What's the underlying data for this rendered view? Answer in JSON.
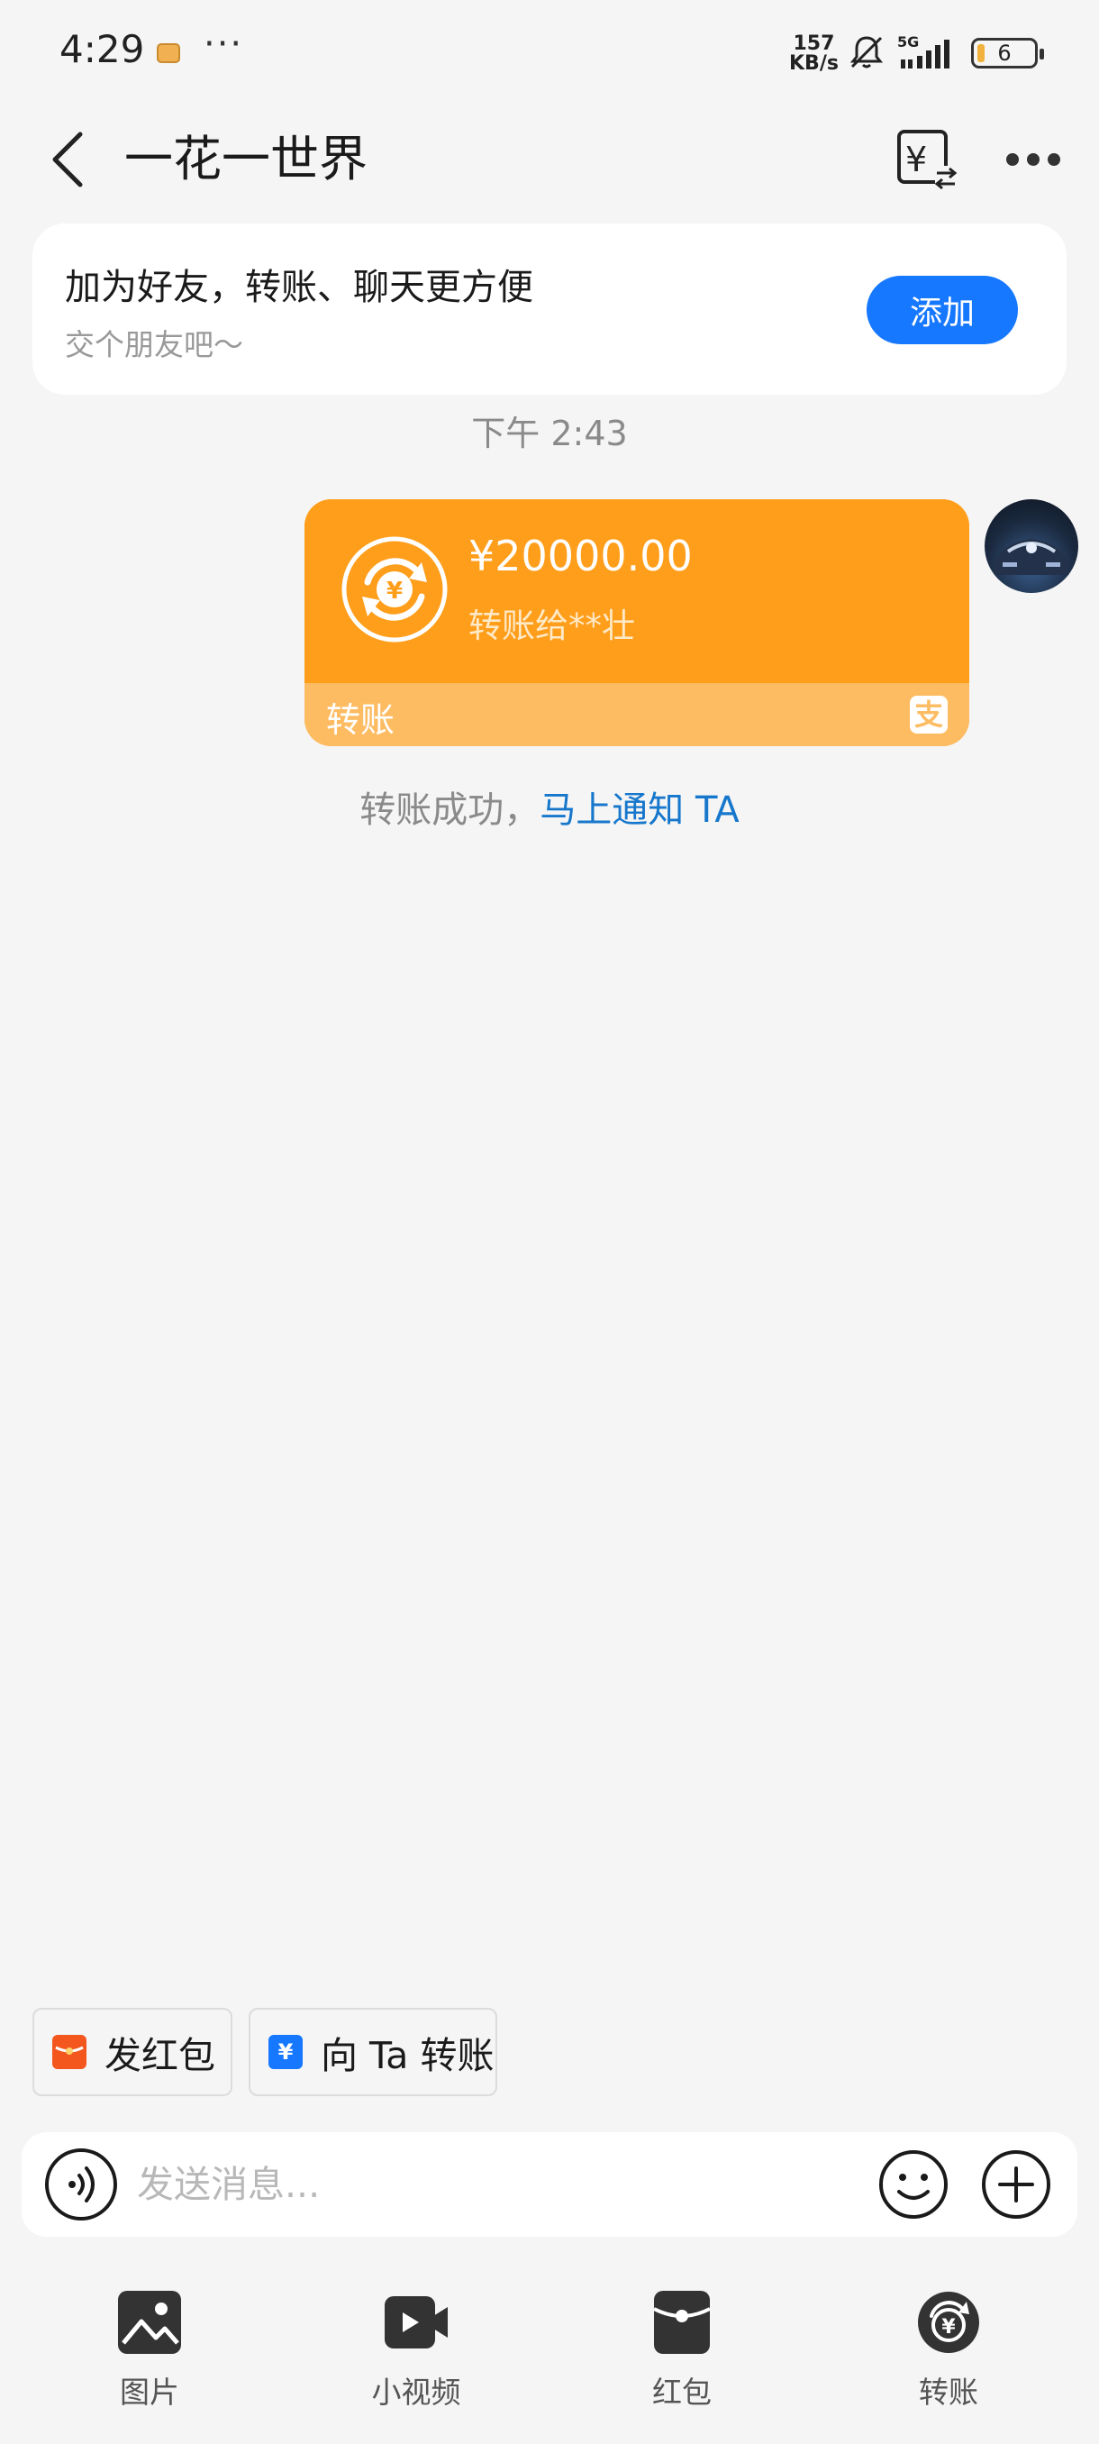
{
  "status_bar": {
    "time": "4:29",
    "dots": "···",
    "net_speed_value": "157",
    "net_speed_unit": "KB/s",
    "network": "5G",
    "battery": "6"
  },
  "header": {
    "title": "一花一世界"
  },
  "friend_card": {
    "title": "加为好友，转账、聊天更方便",
    "subtitle": "交个朋友吧～",
    "add_label": "添加"
  },
  "chat": {
    "timestamp": "下午 2:43",
    "transfer": {
      "amount": "¥20000.00",
      "recipient": "转账给**壮",
      "label": "转账",
      "accent": "#ff9e1b"
    },
    "success_text": "转账成功，",
    "success_link": "马上通知 TA"
  },
  "quick_actions": {
    "red_packet": "发红包",
    "transfer_to": "向 Ta 转账"
  },
  "input": {
    "placeholder": "发送消息..."
  },
  "toolbar": {
    "items": [
      {
        "label": "图片",
        "icon": "image-icon"
      },
      {
        "label": "小视频",
        "icon": "video-icon"
      },
      {
        "label": "红包",
        "icon": "red-packet-icon"
      },
      {
        "label": "转账",
        "icon": "transfer-icon"
      }
    ]
  }
}
